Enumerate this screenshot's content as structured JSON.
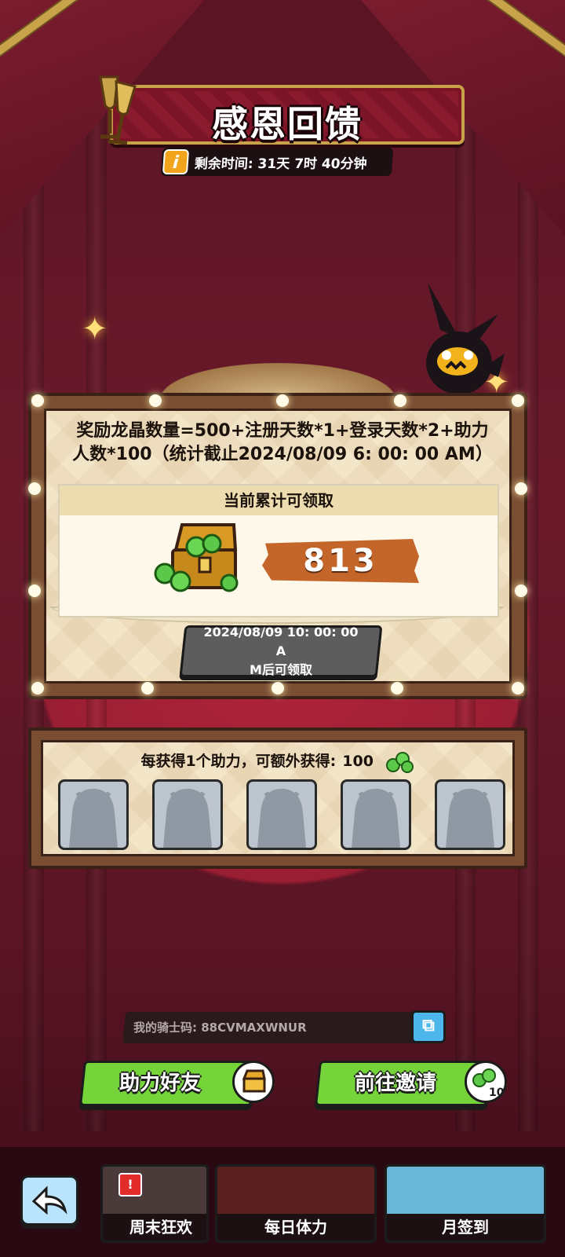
{
  "event": {
    "title": "感恩回馈",
    "timer_text": "剩余时间: 31天 7时 40分钟",
    "info_icon": "info-icon",
    "formula_line1": "奖励龙晶数量=500+注册天数*1+登录天数*2+助力",
    "formula_line2": "人数*100（统计截止2024/08/09 6: 00: 00 AM）"
  },
  "reward_card": {
    "header": "当前累计可领取",
    "amount": "813",
    "claim_time_line1": "2024/08/09 10: 00: 00 A",
    "claim_time_line2": "M后可领取"
  },
  "helpers": {
    "caption": "每获得1个助力，可额外获得:",
    "bonus": "100",
    "slots": [
      "empty",
      "empty",
      "empty",
      "empty",
      "empty"
    ]
  },
  "knight_code": {
    "label": "我的骑士码: 88CVMAXWNUR",
    "copy_icon": "copy-icon"
  },
  "actions": {
    "help_friend": "助力好友",
    "invite": "前往邀请",
    "invite_badge": "10"
  },
  "bottom_nav": {
    "items": [
      "周末狂欢",
      "每日体力",
      "月签到"
    ]
  },
  "colors": {
    "accent_green": "#74d43a",
    "gold": "#c8a34a",
    "banner_red": "#7c1426",
    "amount_orange": "#c4662a"
  }
}
